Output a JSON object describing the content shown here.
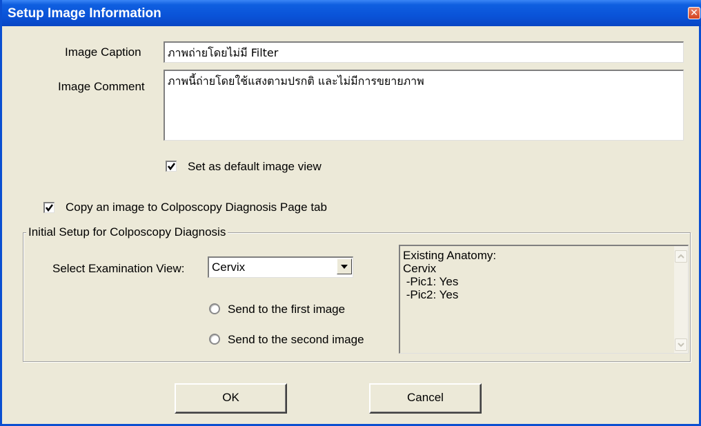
{
  "window": {
    "title": "Setup Image Information"
  },
  "form": {
    "caption_label": "Image Caption",
    "caption_value": "ภาพถ่ายโดยไม่มี Filter",
    "comment_label": "Image Comment",
    "comment_value": "ภาพนี้ถ่ายโดยใช้แสงตามปรกติ และไม่มีการขยายภาพ",
    "default_view_label": "Set as default image view",
    "default_view_checked": true,
    "copy_label": "Copy an image to Colposcopy Diagnosis Page tab",
    "copy_checked": true
  },
  "group": {
    "title": "Initial Setup for Colposcopy Diagnosis",
    "exam_view_label": "Select Examination View:",
    "exam_view_value": "Cervix",
    "radio_first_label": "Send to the first image",
    "radio_second_label": "Send to the second image",
    "anatomy_lines": [
      "Existing Anatomy:",
      "Cervix",
      " -Pic1: Yes",
      " -Pic2: Yes"
    ]
  },
  "buttons": {
    "ok": "OK",
    "cancel": "Cancel"
  },
  "colors": {
    "titlebar": "#0a53d8",
    "dialog_bg": "#ece9d8",
    "close_button": "#d3421f"
  },
  "icons": {
    "close": "close-icon",
    "dropdown": "chevron-down-icon",
    "check": "checkmark-icon",
    "scroll_up": "chevron-up-icon",
    "scroll_down": "chevron-down-icon"
  }
}
